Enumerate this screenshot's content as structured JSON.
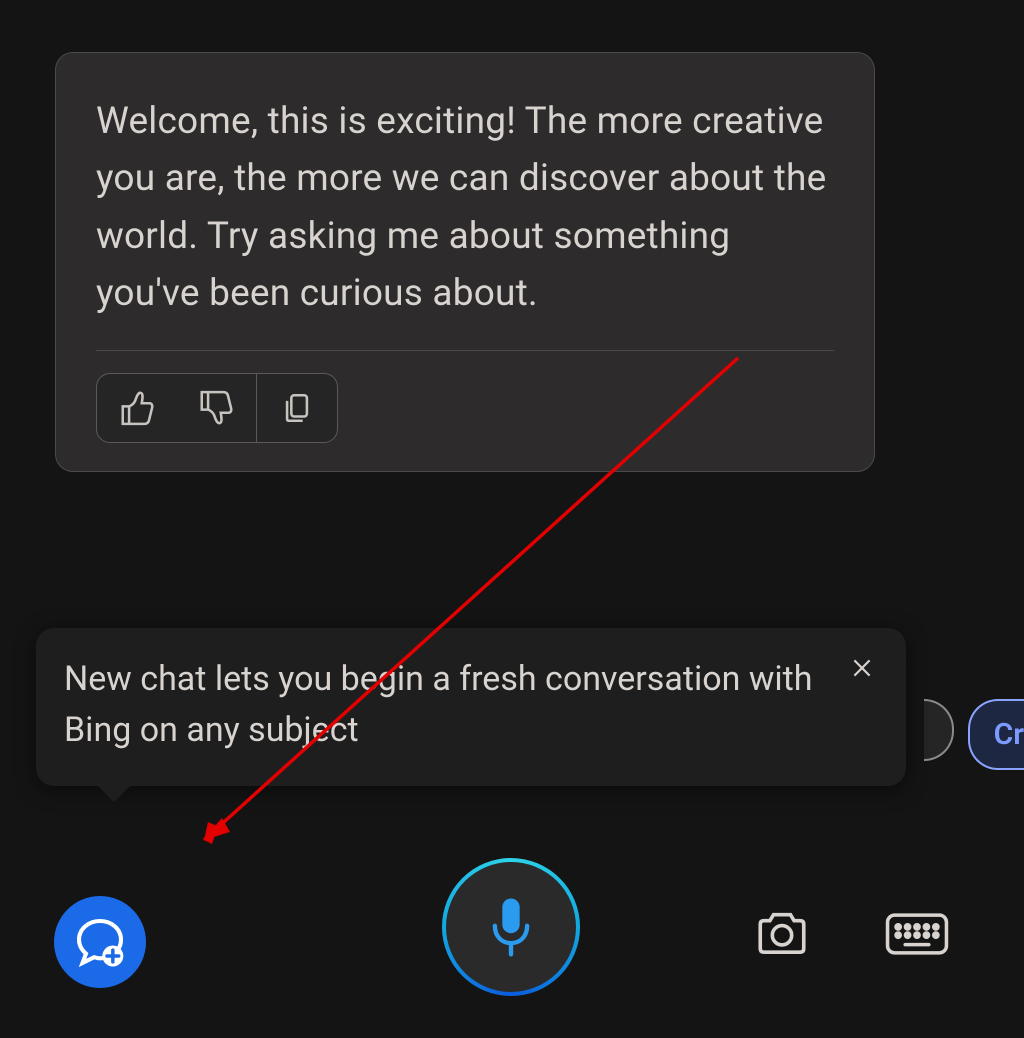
{
  "message": {
    "text": "Welcome, this is exciting! The more creative you are, the more we can discover about the world. Try asking me about something you've been curious about.",
    "actions": {
      "like": "thumbs-up",
      "dislike": "thumbs-down",
      "copy": "copy"
    }
  },
  "tooltip": {
    "text": "New chat lets you begin a fresh conversation with Bing on any subject",
    "close": "close"
  },
  "pill": {
    "creative_partial": "Cr"
  },
  "toolbar": {
    "new_chat": "new-chat",
    "mic": "microphone",
    "camera": "camera",
    "keyboard": "keyboard"
  },
  "annotation": {
    "arrow_color": "#e30000"
  }
}
